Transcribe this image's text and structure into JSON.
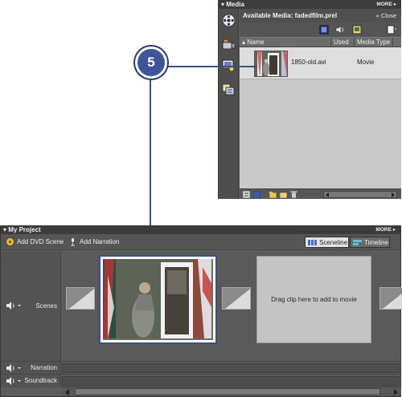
{
  "callout": {
    "number": "5"
  },
  "media_panel": {
    "title": "Media",
    "more_label": "MORE",
    "available_label": "Available Media: fadedfilm.prel",
    "close_label": "Close",
    "columns": {
      "name": "Name",
      "used": "Used",
      "media_type": "Media Type"
    },
    "items": [
      {
        "name": "1850-old.avi",
        "used": "",
        "media_type": "Movie"
      }
    ],
    "sidebar_icons": [
      "film-reel-icon",
      "camera-icon",
      "media-pane-icon",
      "organizer-icon"
    ]
  },
  "project_panel": {
    "title": "My Project",
    "more_label": "MORE",
    "add_dvd_scene": "Add DVD Scene",
    "add_narration": "Add Narration",
    "sceneline_label": "Sceneline",
    "timeline_label": "Timeline",
    "tracks": {
      "scenes": "Scenes",
      "narration": "Narration",
      "soundtrack": "Soundtrack"
    },
    "drop_hint": "Drag clip here to add to movie"
  },
  "colors": {
    "callout": "#3f5499",
    "panel_bg": "#5a5a5a",
    "list_bg": "#c9c9c9"
  }
}
